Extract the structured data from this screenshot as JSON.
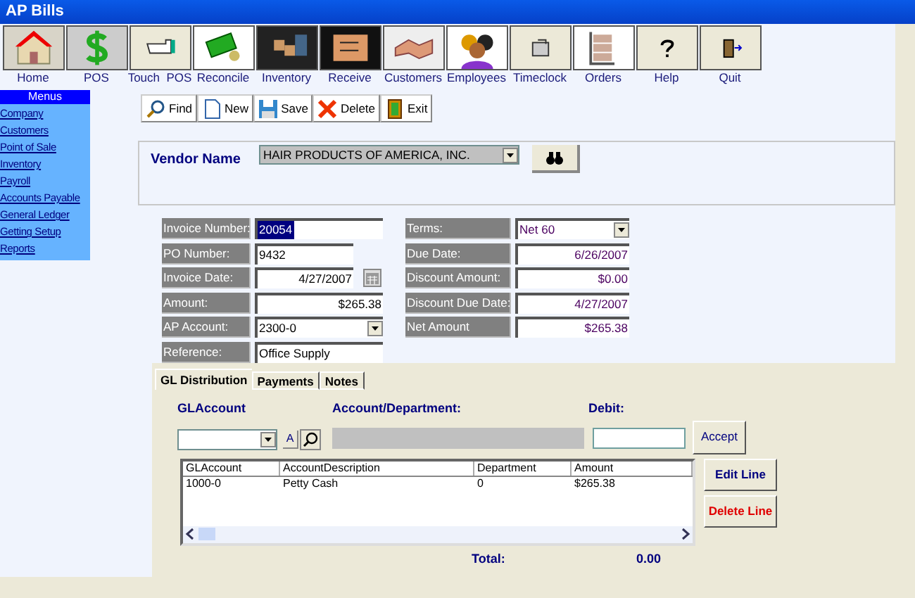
{
  "window": {
    "title": "AP Bills"
  },
  "toolbar": [
    {
      "label": "Home"
    },
    {
      "label": "POS"
    },
    {
      "label": "Touch  POS"
    },
    {
      "label": "Reconcile"
    },
    {
      "label": "Inventory"
    },
    {
      "label": "Receive"
    },
    {
      "label": "Customers"
    },
    {
      "label": "Employees"
    },
    {
      "label": "Timeclock"
    },
    {
      "label": "Orders"
    },
    {
      "label": "Help"
    },
    {
      "label": "Quit"
    }
  ],
  "sidebar": {
    "title": "Menus",
    "items": [
      "Company",
      "Customers",
      "Point of Sale",
      "Inventory",
      "Payroll",
      "Accounts Payable",
      "General Ledger",
      "Getting Setup",
      "Reports"
    ]
  },
  "actions": [
    {
      "label": "Find"
    },
    {
      "label": "New"
    },
    {
      "label": "Save"
    },
    {
      "label": "Delete"
    },
    {
      "label": "Exit"
    }
  ],
  "vendor": {
    "label": "Vendor Name",
    "value": "HAIR PRODUCTS OF AMERICA, INC."
  },
  "fields_left": [
    {
      "label": "Invoice Number:",
      "value": "20054",
      "kind": "text",
      "highlighted": true
    },
    {
      "label": "PO Number:",
      "value": "9432",
      "kind": "short",
      "highlighted": false
    },
    {
      "label": "Invoice Date:",
      "value": "4/27/2007",
      "kind": "date",
      "highlighted": false
    },
    {
      "label": "Amount:",
      "value": "$265.38",
      "kind": "number",
      "highlighted": false
    },
    {
      "label": "AP Account:",
      "value": "2300-0",
      "kind": "dropdown",
      "highlighted": false
    },
    {
      "label": "Reference:",
      "value": "Office Supply",
      "kind": "text",
      "highlighted": false
    }
  ],
  "fields_right": [
    {
      "label": "Terms:",
      "value": "Net 60",
      "kind": "dropdown"
    },
    {
      "label": "Due Date:",
      "value": "6/26/2007",
      "kind": "number"
    },
    {
      "label": "Discount Amount:",
      "value": "$0.00",
      "kind": "number"
    },
    {
      "label": "Discount Due Date:",
      "value": "4/27/2007",
      "kind": "number"
    },
    {
      "label": "Net Amount",
      "value": "$265.38",
      "kind": "number"
    }
  ],
  "tabs": [
    {
      "label": "GL Distribution",
      "selected": true
    },
    {
      "label": "Payments",
      "selected": false
    },
    {
      "label": "Notes",
      "selected": false
    }
  ],
  "gl_entry": {
    "account_label": "GLAccount",
    "department_label": "Account/Department:",
    "debit_label": "Debit:",
    "alpha_button": "A",
    "accept_button": "Accept"
  },
  "grid": {
    "columns": [
      "GLAccount",
      "AccountDescription",
      "Department",
      "Amount"
    ],
    "rows": [
      [
        "1000-0",
        "Petty Cash",
        "0",
        "$265.38"
      ]
    ]
  },
  "line_buttons": [
    {
      "label": "Edit Line",
      "kind": "normal"
    },
    {
      "label": "Delete Line",
      "kind": "danger"
    }
  ],
  "total": {
    "label": "Total:",
    "value": "0.00"
  }
}
